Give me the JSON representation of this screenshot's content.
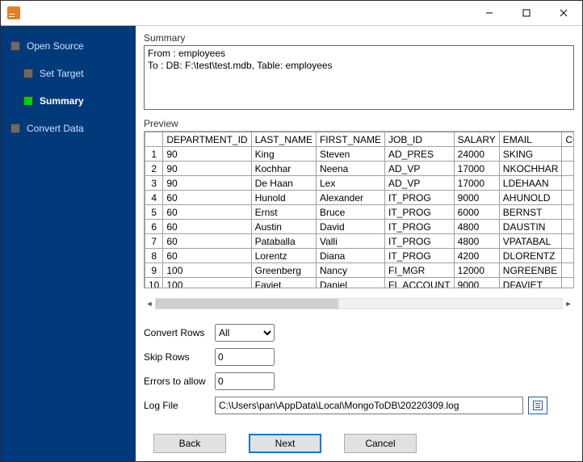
{
  "window": {
    "title": ""
  },
  "sidebar": {
    "items": [
      {
        "label": "Open Source"
      },
      {
        "label": "Set Target"
      },
      {
        "label": "Summary"
      },
      {
        "label": "Convert Data"
      }
    ]
  },
  "summary": {
    "label": "Summary",
    "text": "From : employees\nTo : DB: F:\\test\\test.mdb, Table: employees"
  },
  "preview": {
    "label": "Preview",
    "columns": [
      "DEPARTMENT_ID",
      "LAST_NAME",
      "FIRST_NAME",
      "JOB_ID",
      "SALARY",
      "EMAIL",
      "COMMIS"
    ],
    "rows": [
      {
        "n": "1",
        "DEPARTMENT_ID": "90",
        "LAST_NAME": "King",
        "FIRST_NAME": "Steven",
        "JOB_ID": "AD_PRES",
        "SALARY": "24000",
        "EMAIL": "SKING",
        "COMMIS": ""
      },
      {
        "n": "2",
        "DEPARTMENT_ID": "90",
        "LAST_NAME": "Kochhar",
        "FIRST_NAME": "Neena",
        "JOB_ID": "AD_VP",
        "SALARY": "17000",
        "EMAIL": "NKOCHHAR",
        "COMMIS": ""
      },
      {
        "n": "3",
        "DEPARTMENT_ID": "90",
        "LAST_NAME": "De Haan",
        "FIRST_NAME": "Lex",
        "JOB_ID": "AD_VP",
        "SALARY": "17000",
        "EMAIL": "LDEHAAN",
        "COMMIS": ""
      },
      {
        "n": "4",
        "DEPARTMENT_ID": "60",
        "LAST_NAME": "Hunold",
        "FIRST_NAME": "Alexander",
        "JOB_ID": "IT_PROG",
        "SALARY": "9000",
        "EMAIL": "AHUNOLD",
        "COMMIS": ""
      },
      {
        "n": "5",
        "DEPARTMENT_ID": "60",
        "LAST_NAME": "Ernst",
        "FIRST_NAME": "Bruce",
        "JOB_ID": "IT_PROG",
        "SALARY": "6000",
        "EMAIL": "BERNST",
        "COMMIS": ""
      },
      {
        "n": "6",
        "DEPARTMENT_ID": "60",
        "LAST_NAME": "Austin",
        "FIRST_NAME": "David",
        "JOB_ID": "IT_PROG",
        "SALARY": "4800",
        "EMAIL": "DAUSTIN",
        "COMMIS": ""
      },
      {
        "n": "7",
        "DEPARTMENT_ID": "60",
        "LAST_NAME": "Pataballa",
        "FIRST_NAME": "Valli",
        "JOB_ID": "IT_PROG",
        "SALARY": "4800",
        "EMAIL": "VPATABAL",
        "COMMIS": ""
      },
      {
        "n": "8",
        "DEPARTMENT_ID": "60",
        "LAST_NAME": "Lorentz",
        "FIRST_NAME": "Diana",
        "JOB_ID": "IT_PROG",
        "SALARY": "4200",
        "EMAIL": "DLORENTZ",
        "COMMIS": ""
      },
      {
        "n": "9",
        "DEPARTMENT_ID": "100",
        "LAST_NAME": "Greenberg",
        "FIRST_NAME": "Nancy",
        "JOB_ID": "FI_MGR",
        "SALARY": "12000",
        "EMAIL": "NGREENBE",
        "COMMIS": ""
      },
      {
        "n": "10",
        "DEPARTMENT_ID": "100",
        "LAST_NAME": "Faviet",
        "FIRST_NAME": "Daniel",
        "JOB_ID": "FI_ACCOUNT",
        "SALARY": "9000",
        "EMAIL": "DFAVIET",
        "COMMIS": ""
      }
    ]
  },
  "form": {
    "convertRows": {
      "label": "Convert Rows",
      "value": "All"
    },
    "skipRows": {
      "label": "Skip Rows",
      "value": "0"
    },
    "errorsToAllow": {
      "label": "Errors to allow",
      "value": "0"
    },
    "logFile": {
      "label": "Log File",
      "value": "C:\\Users\\pan\\AppData\\Local\\MongoToDB\\20220309.log"
    }
  },
  "buttons": {
    "back": "Back",
    "next": "Next",
    "cancel": "Cancel"
  }
}
